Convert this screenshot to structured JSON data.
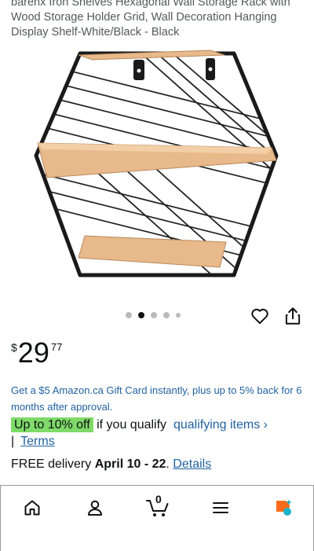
{
  "product": {
    "title": "barenx Iron Shelves Hexagonal Wall Storage Rack with Wood Storage Holder Grid, Wall Decoration Hanging Display Shelf-White/Black - Black"
  },
  "gallery": {
    "image_count": 5,
    "active_index": 1
  },
  "price": {
    "symbol": "$",
    "whole": "29",
    "fraction": "77"
  },
  "promo": {
    "text": "Get a $5 Amazon.ca Gift Card instantly, plus up to 5% back for 6 months after approval."
  },
  "deal": {
    "badge": "Up to 10% off",
    "suffix": " if you qualify",
    "link": "qualifying items ›",
    "separator": "|",
    "terms": "Terms"
  },
  "delivery": {
    "prefix": "FREE delivery ",
    "dates": "April 10 - 22",
    "sep": ". ",
    "details": "Details"
  },
  "nav": {
    "cart_count": "0"
  },
  "colors": {
    "link": "#2162a1",
    "deal_badge": "#7fda69",
    "wood": "#e8b98a"
  },
  "icons": [
    "heart-icon",
    "share-icon",
    "home-icon",
    "account-icon",
    "cart-icon",
    "menu-icon",
    "rufus-icon"
  ]
}
